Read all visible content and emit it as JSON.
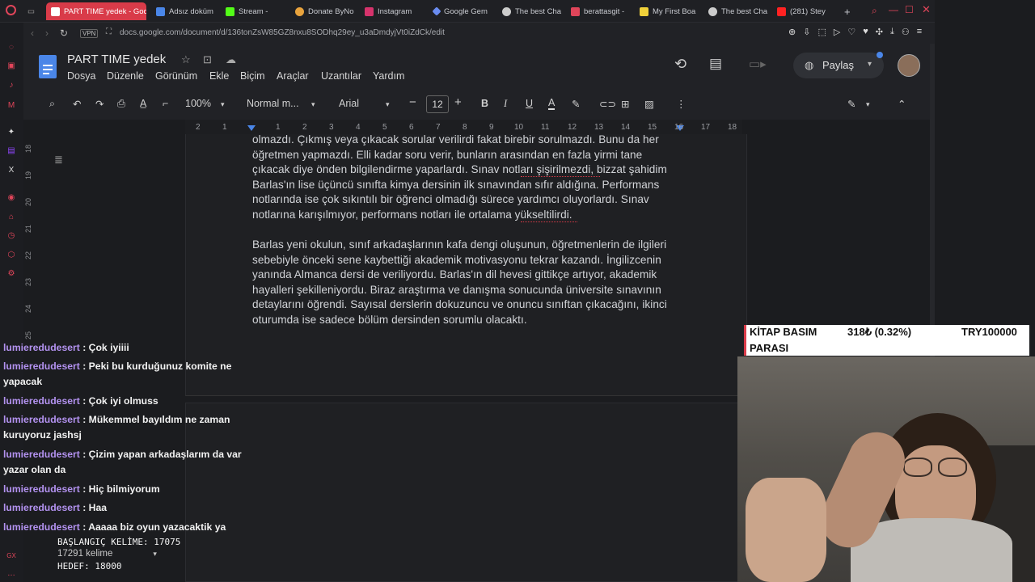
{
  "browser": {
    "tabs": [
      {
        "label": "PART TIME yedek - Goo",
        "active": true
      },
      {
        "label": "Adsız doküm"
      },
      {
        "label": "Stream -"
      },
      {
        "label": "Donate ByNo"
      },
      {
        "label": "Instagram"
      },
      {
        "label": "Google Gem"
      },
      {
        "label": "The best Cha"
      },
      {
        "label": "berattasgit -"
      },
      {
        "label": "My First Boa"
      },
      {
        "label": "The best Cha"
      },
      {
        "label": "(281) Stey"
      }
    ],
    "url": "docs.google.com/document/d/136tonZsW85GZ8nxu8SODhq29ey_u3aDmdyjVt0iZdCk/edit",
    "vpn_label": "VPN"
  },
  "docs": {
    "title": "PART TIME yedek",
    "menus": [
      "Dosya",
      "Düzenle",
      "Görünüm",
      "Ekle",
      "Biçim",
      "Araçlar",
      "Uzantılar",
      "Yardım"
    ],
    "share_label": "Paylaş",
    "toolbar": {
      "zoom": "100%",
      "style": "Normal m...",
      "font": "Arial",
      "font_size": "12"
    },
    "ruler": [
      "2",
      "1",
      "1",
      "2",
      "3",
      "4",
      "5",
      "6",
      "7",
      "8",
      "9",
      "10",
      "11",
      "12",
      "13",
      "14",
      "15",
      "16",
      "17",
      "18"
    ],
    "vertical_ruler": [
      "18",
      "19",
      "20",
      "21",
      "22",
      "23",
      "24",
      "25"
    ]
  },
  "document": {
    "paragraph1_lines": [
      "olmazdı. Çıkmış veya çıkacak sorular verilirdi fakat birebir sorulmazdı. Bunu da her",
      "öğretmen yapmazdı. Elli kadar soru verir, bunların arasından en fazla yirmi tane",
      "çıkacak diye önden bilgilendirme yaparlardı. Sınav notları şişirilmezdi, bizzat şahidim",
      "Barlas'ın lise üçüncü sınıfta kimya dersinin ilk sınavından sıfır aldığına. Performans",
      "notlarında ise çok sıkıntılı bir öğrenci olmadığı sürece yardımcı oluyorlardı. Sınav",
      "notlarına karışılmıyor, performans notları ile ortalama yükseltilirdi."
    ],
    "paragraph2_lines": [
      "Barlas yeni okulun, sınıf arkadaşlarının kafa dengi oluşunun, öğretmenlerin de ilgileri",
      "sebebiyle önceki sene kaybettiği akademik motivasyonu tekrar kazandı. İngilizcenin",
      "yanında Almanca dersi de veriliyordu. Barlas'ın dil hevesi gittikçe artıyor, akademik",
      "hayalleri şekilleniyordu. Biraz araştırma ve danışma sonucunda üniversite sınavının",
      "detaylarını öğrendi. Sayısal derslerin dokuzuncu ve onuncu sınıftan çıkacağını, ikinci",
      "oturumda ise sadece bölüm dersinden sorumlu olacaktı."
    ]
  },
  "chat": [
    {
      "user": "lumieredudesert",
      "message": "Çok iyiiii"
    },
    {
      "user": "lumieredudesert",
      "message": "Peki bu kurduğunuz komite ne yapacak"
    },
    {
      "user": "lumieredudesert",
      "message": "Çok iyi olmuss"
    },
    {
      "user": "lumieredudesert",
      "message": "Mükemmel bayıldım ne zaman kuruyoruz jashsj"
    },
    {
      "user": "lumieredudesert",
      "message": "Çizim yapan arkadaşlarım da var yazar olan da"
    },
    {
      "user": "lumieredudesert",
      "message": "Hiç bilmiyorum"
    },
    {
      "user": "lumieredudesert",
      "message": "Haa"
    },
    {
      "user": "lumieredudesert",
      "message": "Aaaaa biz oyun yazacaktik ya"
    }
  ],
  "counter": {
    "start_label": "BAŞLANGIÇ KELİME: 17075",
    "word_count": "17291 kelime",
    "target_label": "HEDEF: 18000"
  },
  "ticker": {
    "title_line1": "KİTAP BASIM",
    "title_line2": "PARASI",
    "amount": "318₺ (0.32%)",
    "goal": "TRY100000"
  },
  "colors": {
    "accent": "#d93b49",
    "chat_user": "#b392f0"
  }
}
